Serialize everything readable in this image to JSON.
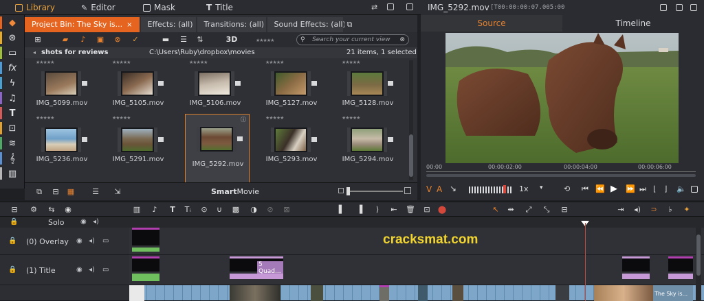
{
  "topbar": {
    "library": "Library",
    "editor": "Editor",
    "mask": "Mask",
    "title": "Title"
  },
  "library": {
    "tabs": [
      {
        "label": "Project Bin: The Sky is...",
        "close": "×"
      },
      {
        "label": "Effects: (all)"
      },
      {
        "label": "Transitions: (all)"
      },
      {
        "label": "Sound Effects: (all)"
      }
    ],
    "toolbar": {
      "view_3d": "3D",
      "search_placeholder": "Search your current view"
    },
    "folder": "shots for reviews",
    "path": "C:\\Users\\Ruby\\dropbox\\movies",
    "count": "21 items, 1 selected",
    "items": [
      {
        "name": "IMG_5099.mov"
      },
      {
        "name": "IMG_5105.mov"
      },
      {
        "name": "IMG_5106.mov"
      },
      {
        "name": "IMG_5127.mov"
      },
      {
        "name": "IMG_5128.mov"
      },
      {
        "name": "IMG_5236.mov"
      },
      {
        "name": "IMG_5291.mov"
      },
      {
        "name": "IMG_5292.mov",
        "selected": true
      },
      {
        "name": "IMG_5293.mov"
      },
      {
        "name": "IMG_5294.mov"
      }
    ],
    "footer": {
      "smartmovie_a": "Smart",
      "smartmovie_b": "Movie"
    }
  },
  "player": {
    "title": "IMG_5292.mov",
    "timecode": "[T00:00:00:07.005:00",
    "tabs": {
      "source": "Source",
      "timeline": "Timeline"
    },
    "ruler": [
      "00:00",
      "00:00:02:00",
      "00:00:04:00",
      "00:00:06:00"
    ],
    "speed": "1x",
    "va": {
      "v": "V",
      "a": "A"
    }
  },
  "timeline": {
    "solo": "Solo",
    "tracks": [
      {
        "name": "(0) Overlay"
      },
      {
        "name": "(1) Title"
      }
    ],
    "clip_title_label": "5 Quad...",
    "clip_end_label": "The Sky is..."
  },
  "watermark": "cracksmat.com",
  "colors": {
    "accent": "#e5641f",
    "clip_green": "#6fbf5e",
    "clip_purple": "#c699d6",
    "watermark": "#f1d430"
  }
}
